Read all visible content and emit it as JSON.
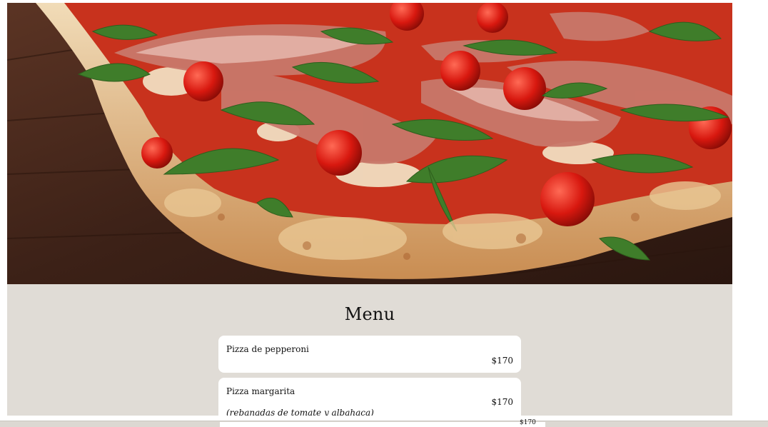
{
  "hero": {
    "image": "pizza-prosciutto-arugula-photo"
  },
  "menu": {
    "title": "Menu",
    "items": [
      {
        "name": "Pizza de pepperoni",
        "price": "$170",
        "description": ""
      },
      {
        "name": "Pizza margarita",
        "price": "$170",
        "description": "(rebanadas de tomate y albahaca)"
      }
    ],
    "peek_price": "$170"
  },
  "colors": {
    "section_bg": "#e0dcd6",
    "card_bg": "#ffffff",
    "text": "#111111"
  }
}
